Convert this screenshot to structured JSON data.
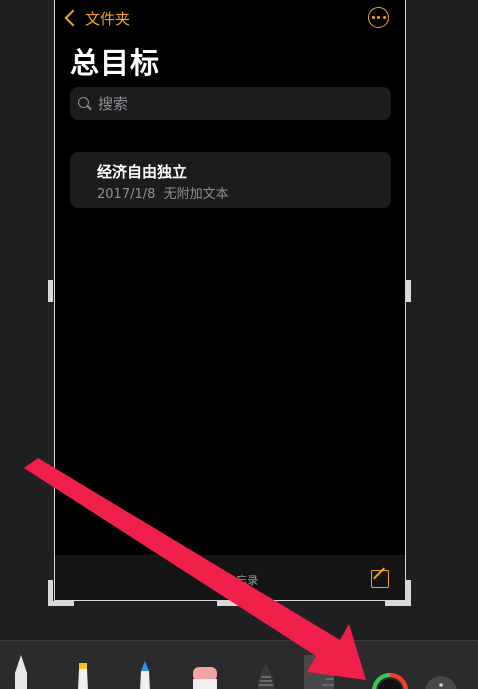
{
  "nav": {
    "back_label": "文件夹"
  },
  "page_title": "总目标",
  "search": {
    "placeholder": "搜索"
  },
  "notes": [
    {
      "title": "经济自由独立",
      "date": "2017/1/8",
      "preview": "无附加文本"
    }
  ],
  "bottom_bar": {
    "count_label": "1 个备忘录"
  },
  "colors": {
    "accent": "#f2a51a",
    "annotation_arrow": "#f0204a",
    "background": "#000000",
    "card": "#1c1c1e"
  },
  "icons": {
    "back": "chevron-left-icon",
    "more": "ellipsis-circle-icon",
    "search": "magnifier-icon",
    "compose": "compose-icon"
  },
  "toolbar_tools": [
    "pen-tool",
    "highlighter-tool",
    "pencil-tool",
    "eraser-tool",
    "lasso-tool",
    "ruler-tool",
    "color-picker",
    "more-tools"
  ]
}
